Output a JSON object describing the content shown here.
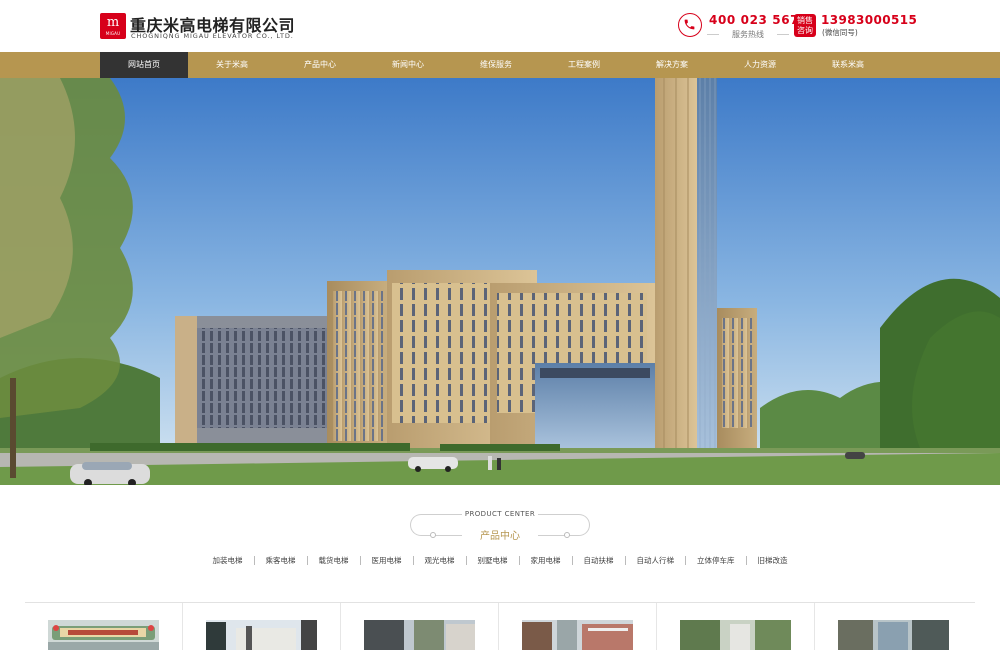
{
  "header": {
    "logo_mark": "m",
    "logo_mark_sub": "MIGAU",
    "brand_cn": "重庆米高电梯有限公司",
    "brand_en": "CHOGNIQNG MIGAU ELEVATOR CO., LTD.",
    "hotline_number": "400 023 5676",
    "hotline_label": "服务热线",
    "sales_badge_line1": "销售",
    "sales_badge_line2": "咨询",
    "sales_number": "13983000515",
    "sales_note": "(微信同号)",
    "accent_color": "#d7001a"
  },
  "nav": {
    "color": "#b69650",
    "active_color": "#333333",
    "items": [
      {
        "label": "网站首页",
        "active": true
      },
      {
        "label": "关于米高"
      },
      {
        "label": "产品中心"
      },
      {
        "label": "新闻中心"
      },
      {
        "label": "维保服务"
      },
      {
        "label": "工程案例"
      },
      {
        "label": "解决方案"
      },
      {
        "label": "人力资源"
      },
      {
        "label": "联系米高"
      }
    ]
  },
  "product_center": {
    "title_en": "PRODUCT CENTER",
    "title_cn": "产品中心",
    "categories": [
      "加装电梯",
      "乘客电梯",
      "载货电梯",
      "医用电梯",
      "观光电梯",
      "别墅电梯",
      "家用电梯",
      "自动扶梯",
      "自动人行梯",
      "立体停车库",
      "旧梯改造"
    ]
  },
  "product_cards": [
    {
      "image": "storefront-photo"
    },
    {
      "image": "building-exterior-photo"
    },
    {
      "image": "building-exterior-photo"
    },
    {
      "image": "building-exterior-photo"
    },
    {
      "image": "building-exterior-photo"
    },
    {
      "image": "building-exterior-photo"
    }
  ]
}
